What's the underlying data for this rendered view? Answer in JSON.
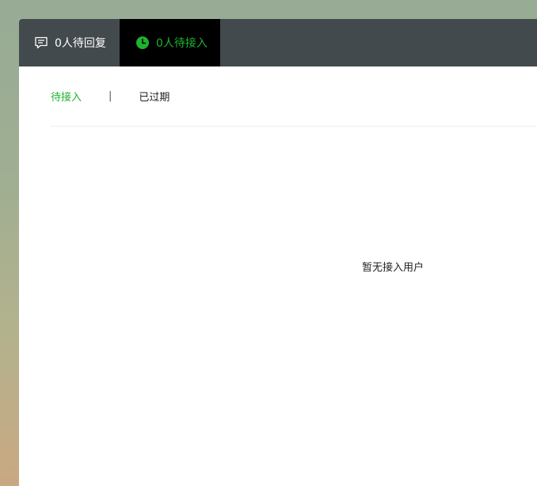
{
  "topbar": {
    "reply_tab": {
      "label": "0人待回复",
      "icon": "chat-bubble-icon"
    },
    "pending_tab": {
      "label": "0人待接入",
      "icon": "clock-icon"
    }
  },
  "subtabs": {
    "active_label": "待接入",
    "separator": "|",
    "expired_label": "已过期"
  },
  "empty_state": {
    "message": "暂无接入用户"
  },
  "colors": {
    "accent": "#1eb22e",
    "topbar_bg": "#434a4d",
    "active_tab_bg": "#000000"
  }
}
